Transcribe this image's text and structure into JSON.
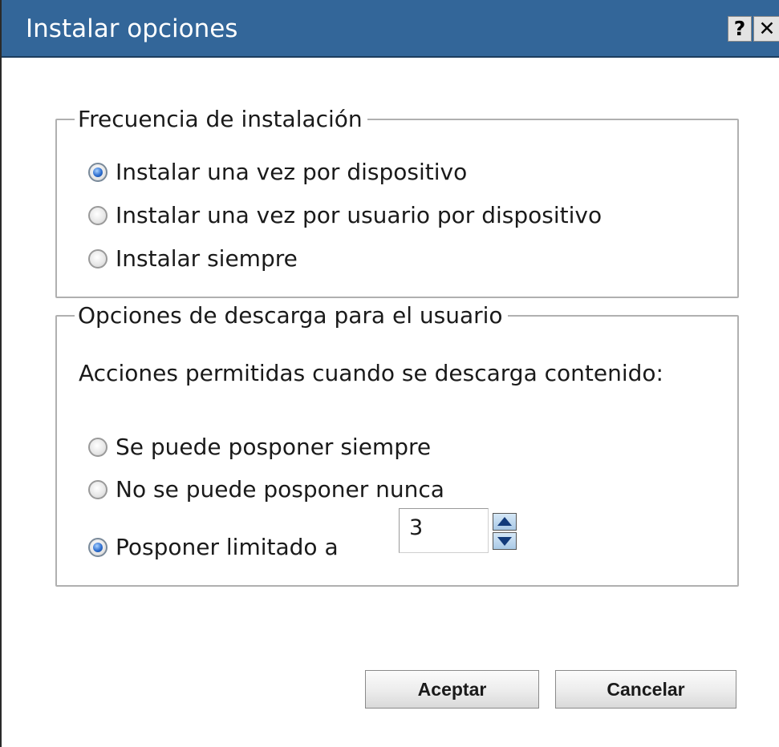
{
  "dialog": {
    "title": "Instalar opciones",
    "help_button": "?",
    "close_button": "✕"
  },
  "install_frequency": {
    "legend": "Frecuencia de instalación",
    "options": [
      {
        "label": "Instalar una vez por dispositivo",
        "selected": true
      },
      {
        "label": "Instalar una vez por usuario por dispositivo",
        "selected": false
      },
      {
        "label": "Instalar siempre",
        "selected": false
      }
    ]
  },
  "download_options": {
    "legend": "Opciones de descarga para el usuario",
    "description": "Acciones permitidas cuando se descarga contenido:",
    "options": [
      {
        "label": "Se puede posponer siempre",
        "selected": false
      },
      {
        "label": "No se puede posponer nunca",
        "selected": false
      },
      {
        "label": "Posponer limitado a",
        "selected": true
      }
    ],
    "postpone_limit_value": "3"
  },
  "buttons": {
    "ok_label": "Aceptar",
    "cancel_label": "Cancelar"
  },
  "colors": {
    "titlebar": "#336699",
    "radio_selected": "#2f6fd0",
    "group_border": "#b0b0b0"
  }
}
